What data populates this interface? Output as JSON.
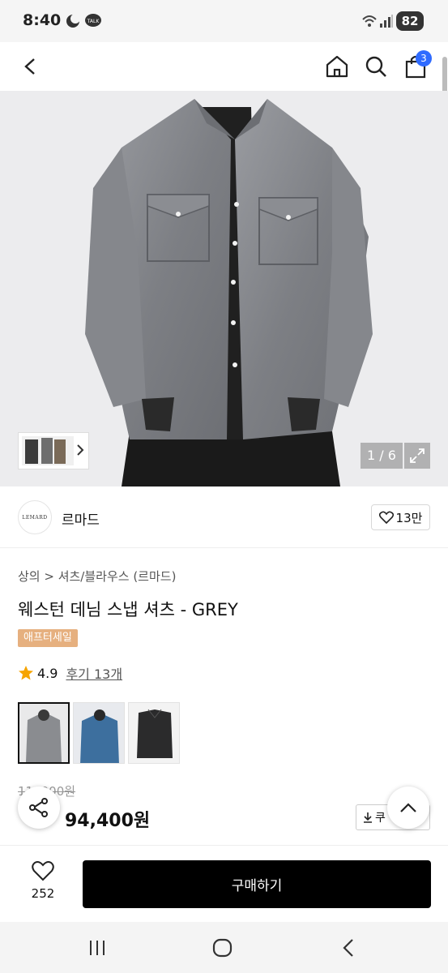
{
  "status_bar": {
    "time": "8:40",
    "battery": "82",
    "notification_icons": [
      "moon-icon",
      "talk-icon"
    ]
  },
  "app_bar": {
    "back_icon": "chevron-left-icon",
    "home_icon": "home-icon",
    "search_icon": "search-icon",
    "cart_icon": "bag-icon",
    "cart_count": "3"
  },
  "gallery": {
    "counter": "1 / 6",
    "thumb_strip_icon": "chevron-right-icon",
    "expand_icon": "expand-icon"
  },
  "brand": {
    "logo_text": "LEMARD",
    "name": "르마드",
    "likes": "13만"
  },
  "product": {
    "breadcrumb": "상의 > 셔츠/블라우스 (르마드)",
    "title": "웨스턴 데님 스냅 셔츠 - GREY",
    "tag": "애프터세일",
    "rating": "4.9",
    "reviews": "후기 13개"
  },
  "price": {
    "original": "11 ,000원",
    "discount_partial": "",
    "sale": "94,400원",
    "coupon_label": "쿠"
  },
  "bottom": {
    "wish_count": "252",
    "buy_label": "구매하기"
  },
  "colors": {
    "accent": "#2f6bff",
    "sale_red": "#ef3e2f",
    "tag_orange": "#e6b07f",
    "star": "#f6a400",
    "buy_bg": "#000000"
  }
}
